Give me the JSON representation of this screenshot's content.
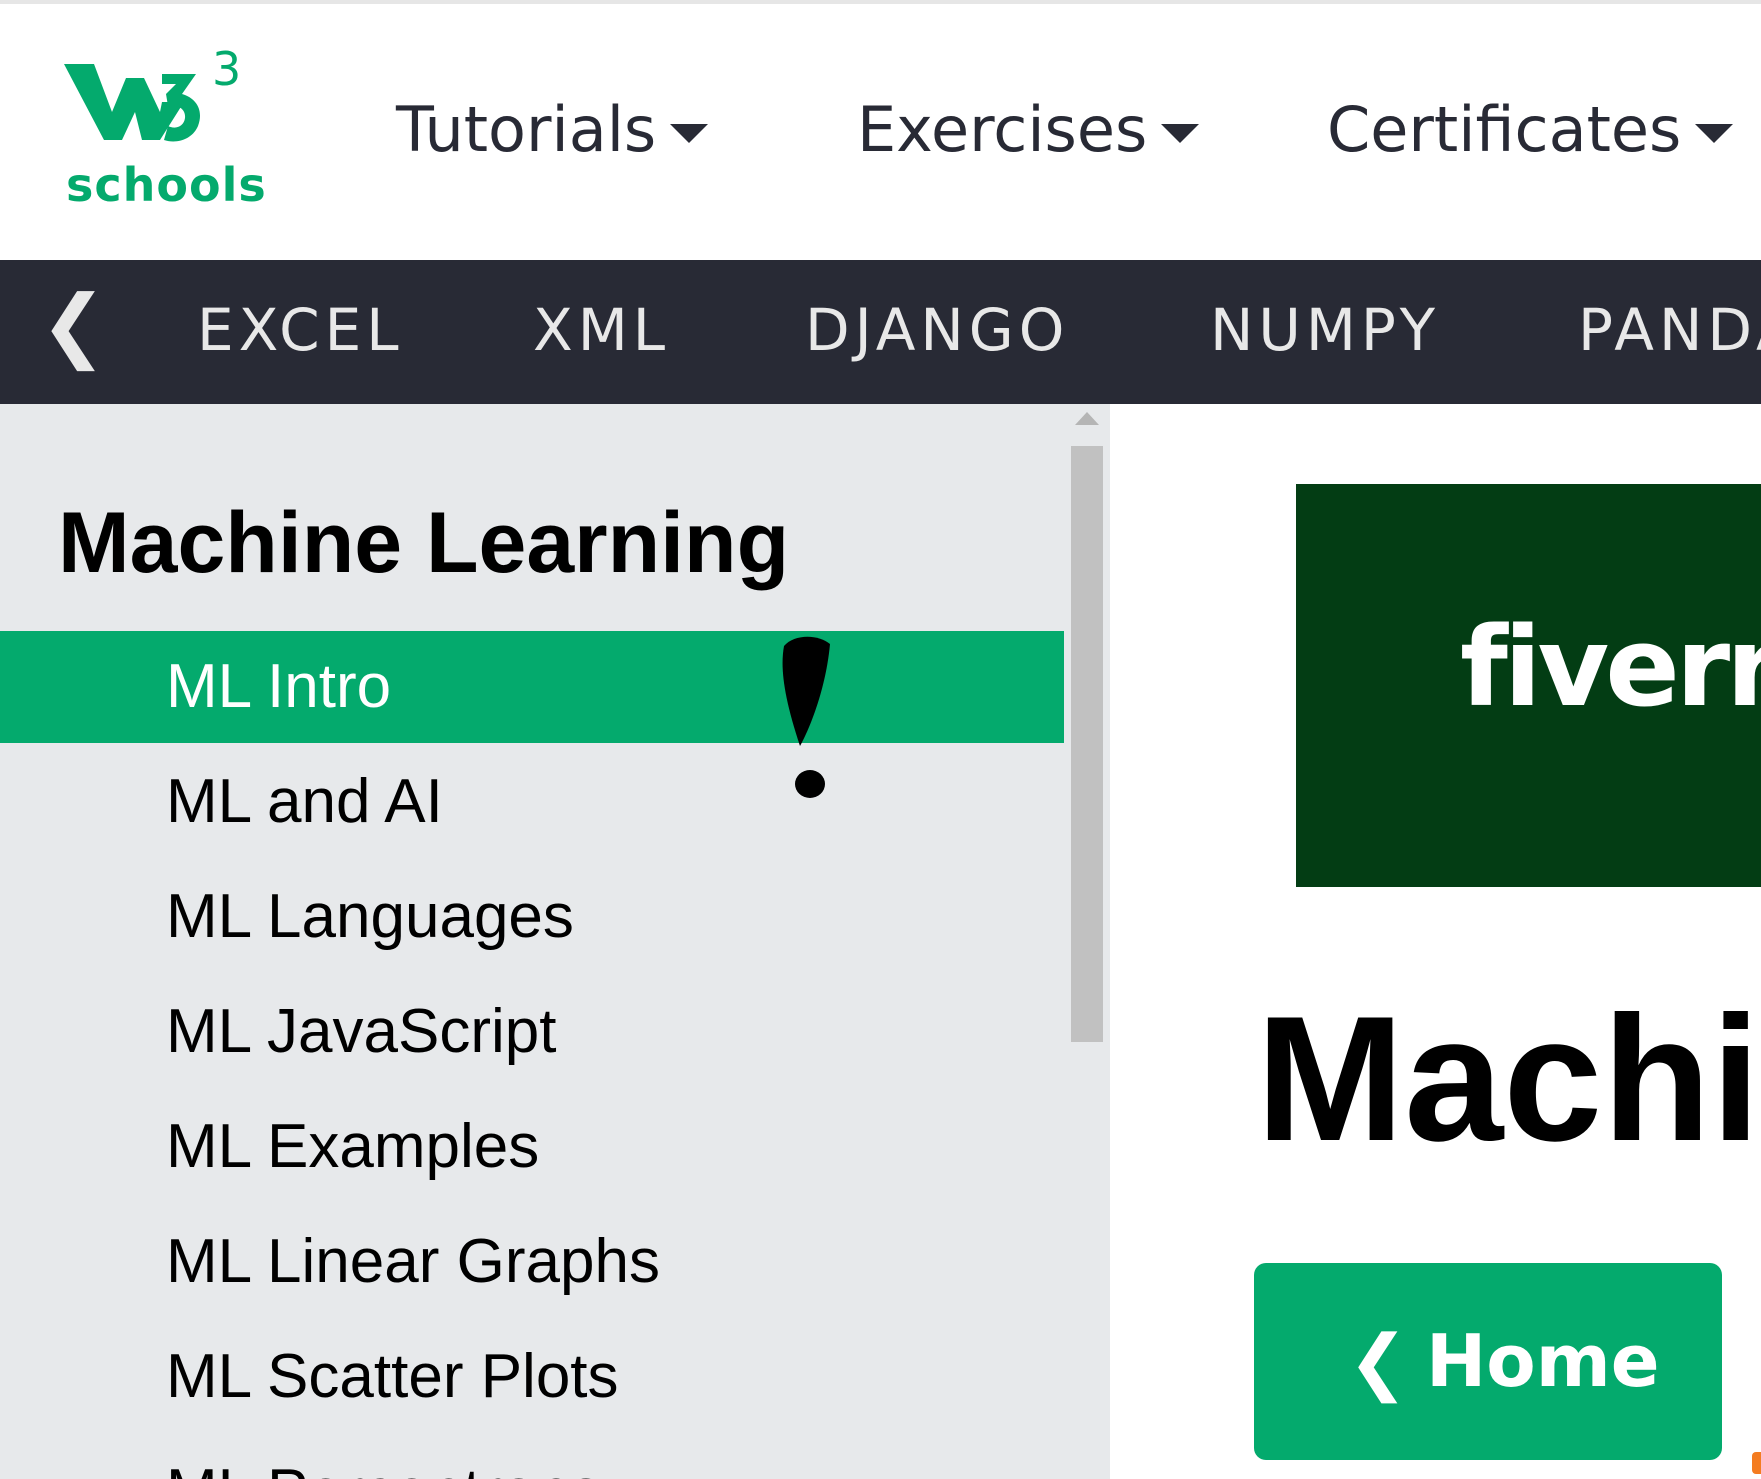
{
  "logo": {
    "superscript": "3",
    "text": "schools",
    "color": "#04aa6d"
  },
  "topnav": {
    "items": [
      {
        "label": "Tutorials",
        "icon": "caret-down-icon"
      },
      {
        "label": "Exercises",
        "icon": "caret-down-icon"
      },
      {
        "label": "Certificates",
        "icon": "caret-down-icon"
      }
    ]
  },
  "subnav": {
    "prev_icon": "chevron-left-icon",
    "prev_glyph": "❮",
    "items": [
      "EXCEL",
      "XML",
      "DJANGO",
      "NUMPY",
      "PANDA"
    ]
  },
  "sidebar": {
    "title": "Machine Learning",
    "items": [
      {
        "label": "ML Intro",
        "active": true
      },
      {
        "label": "ML and AI"
      },
      {
        "label": "ML Languages"
      },
      {
        "label": "ML JavaScript"
      },
      {
        "label": "ML Examples"
      },
      {
        "label": "ML Linear Graphs"
      },
      {
        "label": "ML Scatter Plots"
      },
      {
        "label": "ML Perceptrons"
      }
    ]
  },
  "ad": {
    "text": "fiverr",
    "background": "#033d14"
  },
  "main": {
    "heading": "Machi",
    "home_button": {
      "arrow_glyph": "❮",
      "label": "Home"
    }
  },
  "colors": {
    "accent": "#04aa6d",
    "dark_nav": "#282a35",
    "sidebar_bg": "#e7e9eb"
  }
}
